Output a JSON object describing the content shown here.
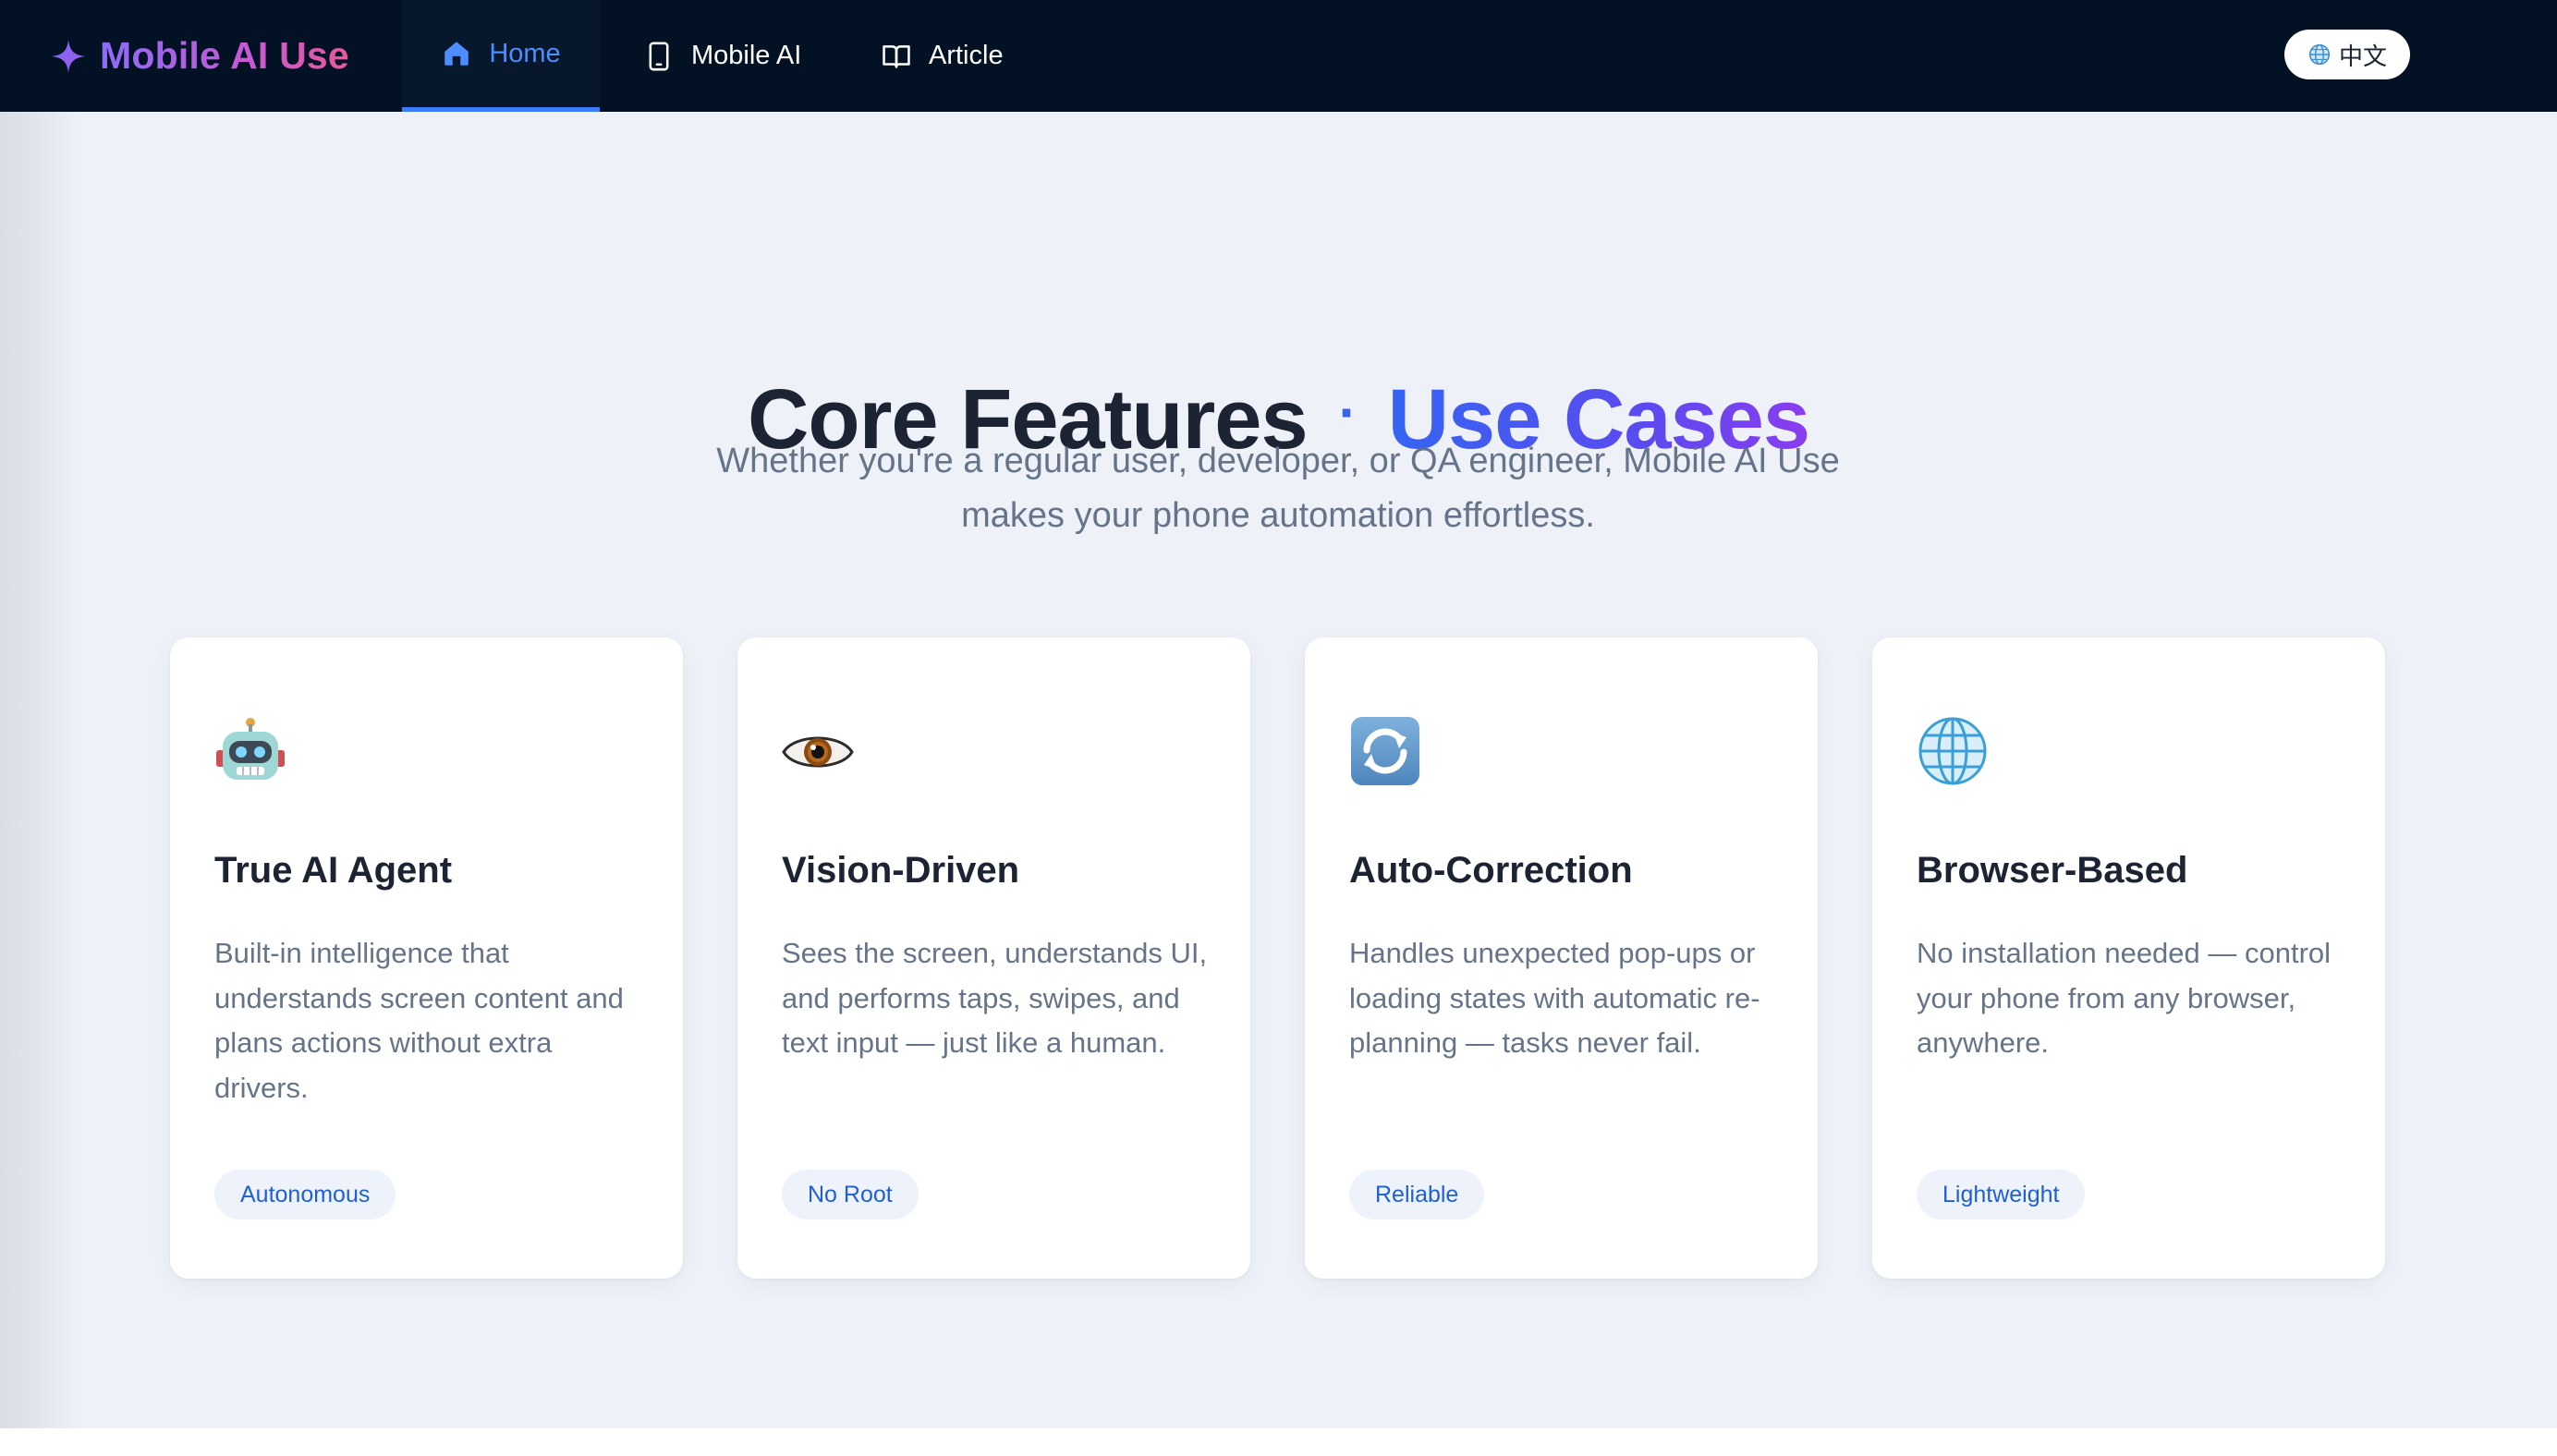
{
  "nav": {
    "brand": "Mobile AI Use",
    "items": [
      {
        "label": "Home",
        "icon": "home-icon",
        "active": true
      },
      {
        "label": "Mobile AI",
        "icon": "phone-icon",
        "active": false
      },
      {
        "label": "Article",
        "icon": "book-icon",
        "active": false
      }
    ],
    "language": "中文"
  },
  "hero": {
    "title_main": "Core Features",
    "title_sep": "·",
    "title_accent": "Use Cases",
    "subtitle": "Whether you're a regular user, developer, or QA engineer, Mobile AI Use makes your phone automation effortless."
  },
  "cards": [
    {
      "icon": "robot-icon",
      "title": "True AI Agent",
      "description": "Built-in intelligence that understands screen content and plans actions without extra drivers.",
      "tag": "Autonomous"
    },
    {
      "icon": "eye-icon",
      "title": "Vision-Driven",
      "description": "Sees the screen, understands UI, and performs taps, swipes, and text input — just like a human.",
      "tag": "No Root"
    },
    {
      "icon": "refresh-icon",
      "title": "Auto-Correction",
      "description": "Handles unexpected pop-ups or loading states with automatic re-planning — tasks never fail.",
      "tag": "Reliable"
    },
    {
      "icon": "globe-icon",
      "title": "Browser-Based",
      "description": "No installation needed — control your phone from any browser, anywhere.",
      "tag": "Lightweight"
    }
  ],
  "colors": {
    "nav_bg": "#021224",
    "accent": "#3a62f0",
    "page_bg": "#eef2f8",
    "tag_text": "#1f5fd6"
  }
}
